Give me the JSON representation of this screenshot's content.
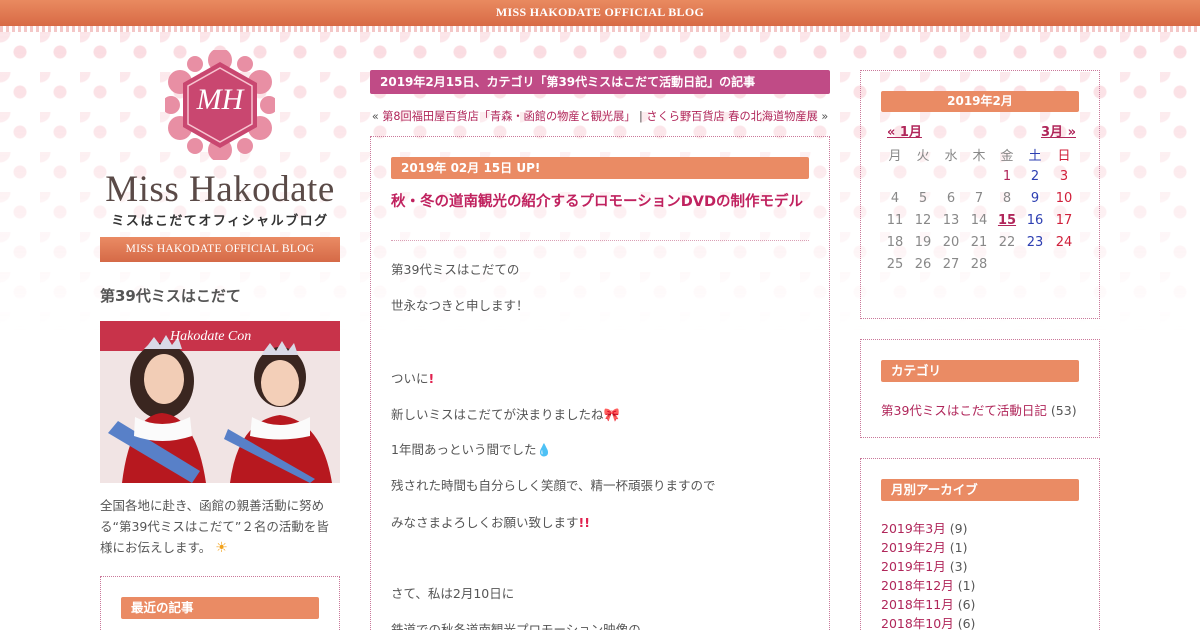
{
  "topbar": {
    "title": "MISS HAKODATE OFFICIAL BLOG"
  },
  "logo": {
    "monogram": "MH",
    "title": "Miss Hakodate",
    "subtitle": "ミスはこだてオフィシャルブログ",
    "banner": "MISS HAKODATE OFFICIAL BLOG"
  },
  "left": {
    "heading": "第39代ミスはこだて",
    "photo_backdrop_text": "Hakodate Con",
    "description_lines": [
      "全国各地に赴き、函館の親善活動に努め",
      "る“第39代ミスはこだて”２名の活動を皆",
      "様にお伝えします。"
    ],
    "sun_icon": "sun-icon",
    "recent_title": "最近の記事"
  },
  "center": {
    "category_bar": "2019年2月15日、カテゴリ「第39代ミスはこだて活動日記」の記事",
    "nav": {
      "prev_prefix": "«",
      "prev": "第8回福田屋百貨店「青森・函館の物産と観光展」",
      "separator": "|",
      "next": "さくら野百貨店 春の北海道物産展",
      "next_suffix": "»"
    },
    "post": {
      "date": "2019年 02月 15日 UP!",
      "title": "秋・冬の道南観光の紹介するプロモーションDVDの制作モデル",
      "paragraphs": [
        "第39代ミスはこだての",
        "世永なつきと申します！",
        "ついに",
        "新しいミスはこだてが決まりましたね",
        "1年間あっという間でした",
        "残された時間も自分らしく笑顔で、精一杯頑張りますので",
        "みなさまよろしくお願い致します",
        "さて、私は2月10日に",
        "鉄道での秋冬道南観光プロモーション映像の"
      ],
      "emoji": {
        "exclaim": "!",
        "double_exclaim": "!!",
        "ribbon": "ribbon-icon",
        "sweat": "sweat-drop-icon"
      }
    }
  },
  "calendar": {
    "title": "2019年2月",
    "prev": "« 1月",
    "next": "3月 »",
    "weekdays": [
      "月",
      "火",
      "水",
      "木",
      "金",
      "土",
      "日"
    ],
    "rows": [
      [
        "",
        "",
        "",
        "",
        "1",
        "2",
        "3"
      ],
      [
        "4",
        "5",
        "6",
        "7",
        "8",
        "9",
        "10"
      ],
      [
        "11",
        "12",
        "13",
        "14",
        "15",
        "16",
        "17"
      ],
      [
        "18",
        "19",
        "20",
        "21",
        "22",
        "23",
        "24"
      ],
      [
        "25",
        "26",
        "27",
        "28",
        "",
        "",
        ""
      ]
    ],
    "linked_days": [
      "1",
      "2",
      "3",
      "9",
      "10",
      "15",
      "16",
      "17",
      "23",
      "24"
    ],
    "today": "15",
    "colors": {
      "saturday": "#2d3fb2",
      "sunday": "#d01f3a",
      "link": "#b0265a"
    }
  },
  "categories": {
    "title": "カテゴリ",
    "items": [
      {
        "label": "第39代ミスはこだて活動日記",
        "count": "(53)"
      }
    ]
  },
  "archives": {
    "title": "月別アーカイブ",
    "items": [
      {
        "label": "2019年3月",
        "count": "(9)"
      },
      {
        "label": "2019年2月",
        "count": "(1)"
      },
      {
        "label": "2019年1月",
        "count": "(3)"
      },
      {
        "label": "2018年12月",
        "count": "(1)"
      },
      {
        "label": "2018年11月",
        "count": "(6)"
      },
      {
        "label": "2018年10月",
        "count": "(6)"
      }
    ]
  },
  "colors": {
    "accent_orange": "#ea8b64",
    "category_bar": "#c04b86",
    "link": "#b0265a",
    "title_red": "#c0225f"
  }
}
